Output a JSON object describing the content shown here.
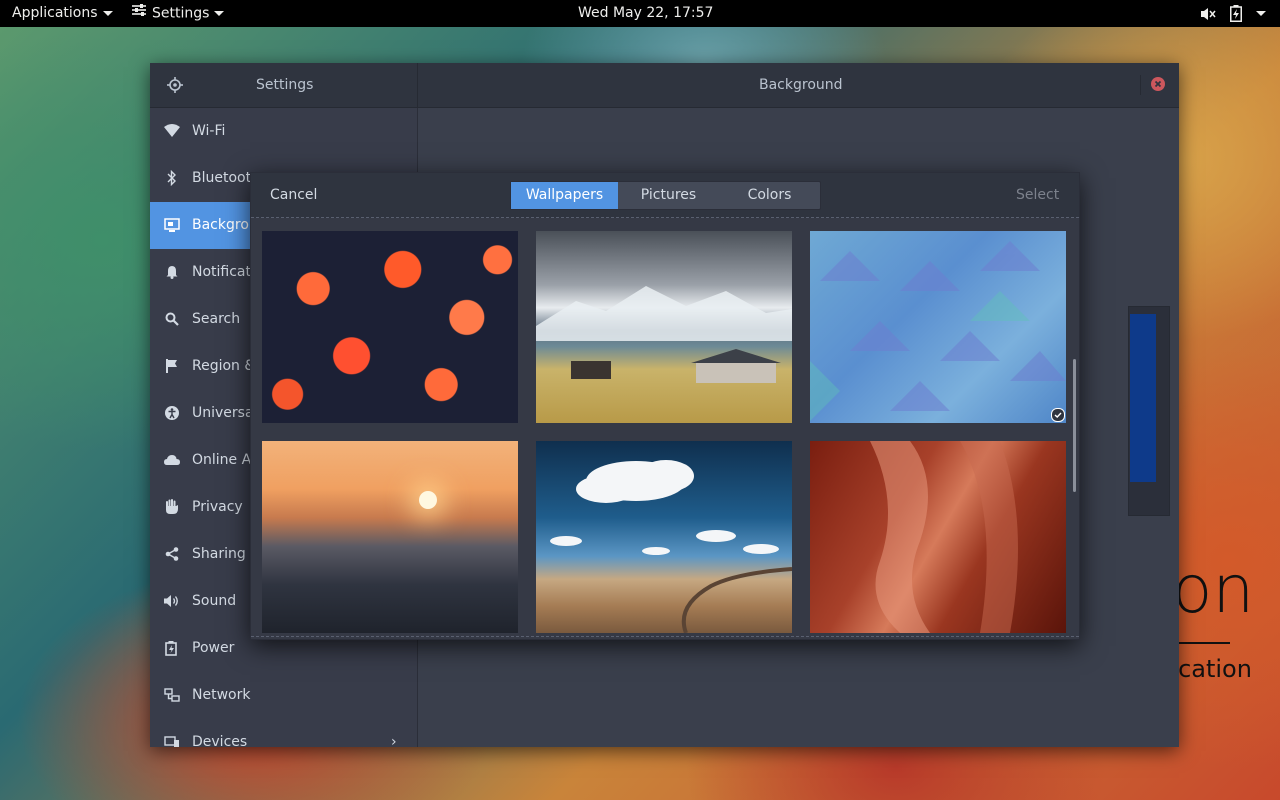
{
  "topbar": {
    "applications_label": "Applications",
    "settings_label": "Settings",
    "clock": "Wed May 22, 17:57"
  },
  "window": {
    "sidebar_title": "Settings",
    "panel_title": "Background",
    "sidebar": {
      "items": [
        {
          "label": "Wi-Fi",
          "icon": "wifi-icon"
        },
        {
          "label": "Bluetoot",
          "icon": "bluetooth-icon"
        },
        {
          "label": "Backgrou",
          "icon": "background-icon"
        },
        {
          "label": "Notificat",
          "icon": "bell-icon"
        },
        {
          "label": "Search",
          "icon": "search-icon"
        },
        {
          "label": "Region &",
          "icon": "flag-icon"
        },
        {
          "label": "Universa",
          "icon": "accessibility-icon"
        },
        {
          "label": "Online A",
          "icon": "cloud-icon"
        },
        {
          "label": "Privacy",
          "icon": "hand-icon"
        },
        {
          "label": "Sharing",
          "icon": "share-icon"
        },
        {
          "label": "Sound",
          "icon": "speaker-icon"
        },
        {
          "label": "Power",
          "icon": "power-icon"
        },
        {
          "label": "Network",
          "icon": "network-icon"
        },
        {
          "label": "Devices",
          "icon": "devices-icon"
        }
      ]
    }
  },
  "dialog": {
    "cancel_label": "Cancel",
    "select_label": "Select",
    "tabs": [
      {
        "label": "Wallpapers",
        "selected": true
      },
      {
        "label": "Pictures",
        "selected": false
      },
      {
        "label": "Colors",
        "selected": false
      }
    ]
  },
  "wallpaper_text": {
    "fragment_large": "on",
    "fragment_small": "tication"
  },
  "colors": {
    "accent": "#5294e2",
    "window_bg": "#353945",
    "header_bg": "#2f343f",
    "close_button": "#cc575d"
  }
}
